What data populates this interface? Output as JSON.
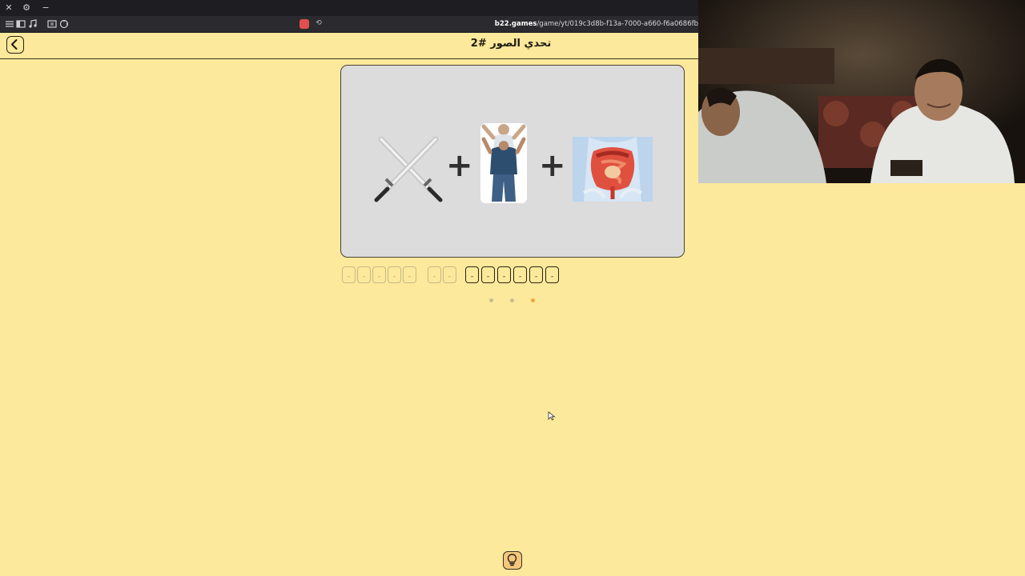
{
  "browser": {
    "url_host": "b22.games",
    "url_path": "/game/yt/019c3d8b-f13a-7000-a660-f6a0686fb"
  },
  "header": {
    "title": "تحدي الصور #2"
  },
  "puzzle": {
    "images": [
      "crossed-swords",
      "father-carrying-child",
      "intestines-anatomy"
    ],
    "operator": "+"
  },
  "answer": {
    "slot_placeholder": "-",
    "words": [
      {
        "letters": 5,
        "state": "dim"
      },
      {
        "letters": 2,
        "state": "dim"
      },
      {
        "letters": 6,
        "state": "active"
      }
    ]
  },
  "progress": {
    "dots": 3,
    "current_index": 2,
    "colors": {
      "inactive": "#c9bd8f",
      "active": "#f0a43a"
    }
  },
  "colors": {
    "background": "#fce99b",
    "text": "#1f1b12",
    "hint_button": "#f4c77d"
  }
}
